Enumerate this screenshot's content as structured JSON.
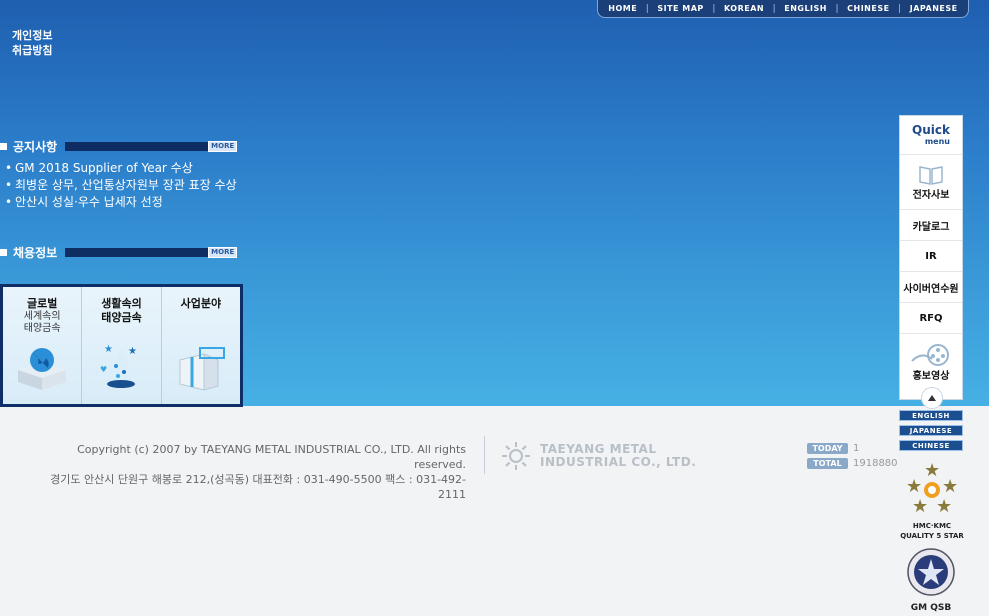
{
  "top_nav": [
    "HOME",
    "SITE MAP",
    "KOREAN",
    "ENGLISH",
    "CHINESE",
    "JAPANESE"
  ],
  "privacy": {
    "line1": "개인정보",
    "line2": "취급방침"
  },
  "notice": {
    "title": "공지사항",
    "more": "MORE",
    "items": [
      "GM 2018 Supplier of Year 수상",
      "최병운 상무, 산업통상자원부 장관 표장 수상",
      "안산시 성실·우수 납세자 선정"
    ]
  },
  "recruit": {
    "title": "채용정보",
    "more": "MORE"
  },
  "business": [
    {
      "title": "글로벌",
      "sub1": "세계속의",
      "sub2": "태양금속"
    },
    {
      "title": "생활속의",
      "sub1": "태양금속",
      "sub2": ""
    },
    {
      "title": "사업분야",
      "sub1": "",
      "sub2": ""
    }
  ],
  "quick_menu": {
    "head1": "Quick",
    "head2": "menu",
    "items": [
      "전자사보",
      "카달로그",
      "IR",
      "사이버연수원",
      "RFQ",
      "홍보영상"
    ]
  },
  "lang_buttons": [
    "ENGLISH",
    "JAPANESE",
    "CHINESE"
  ],
  "footer": {
    "copyright": "Copyright (c) 2007 by TAEYANG METAL INDUSTRIAL CO., LTD. All rights reserved.",
    "address": "경기도 안산시 단원구 해봉로 212,(성곡동) 대표전화 : 031-490-5500 팩스 : 031-492-2111",
    "logo_line1": "TAEYANG METAL",
    "logo_line2": "INDUSTRIAL CO., LTD."
  },
  "counter": {
    "today_label": "TODAY",
    "today_value": "1",
    "total_label": "TOTAL",
    "total_value": "1918880"
  },
  "awards": {
    "hmc_line1": "HMC·KMC",
    "hmc_line2": "QUALITY 5 STAR",
    "gm": "GM QSB"
  },
  "colors": {
    "accent_dark": "#0d2d63",
    "hero_top": "#1f5fb0",
    "hero_bottom": "#46b0e4"
  }
}
